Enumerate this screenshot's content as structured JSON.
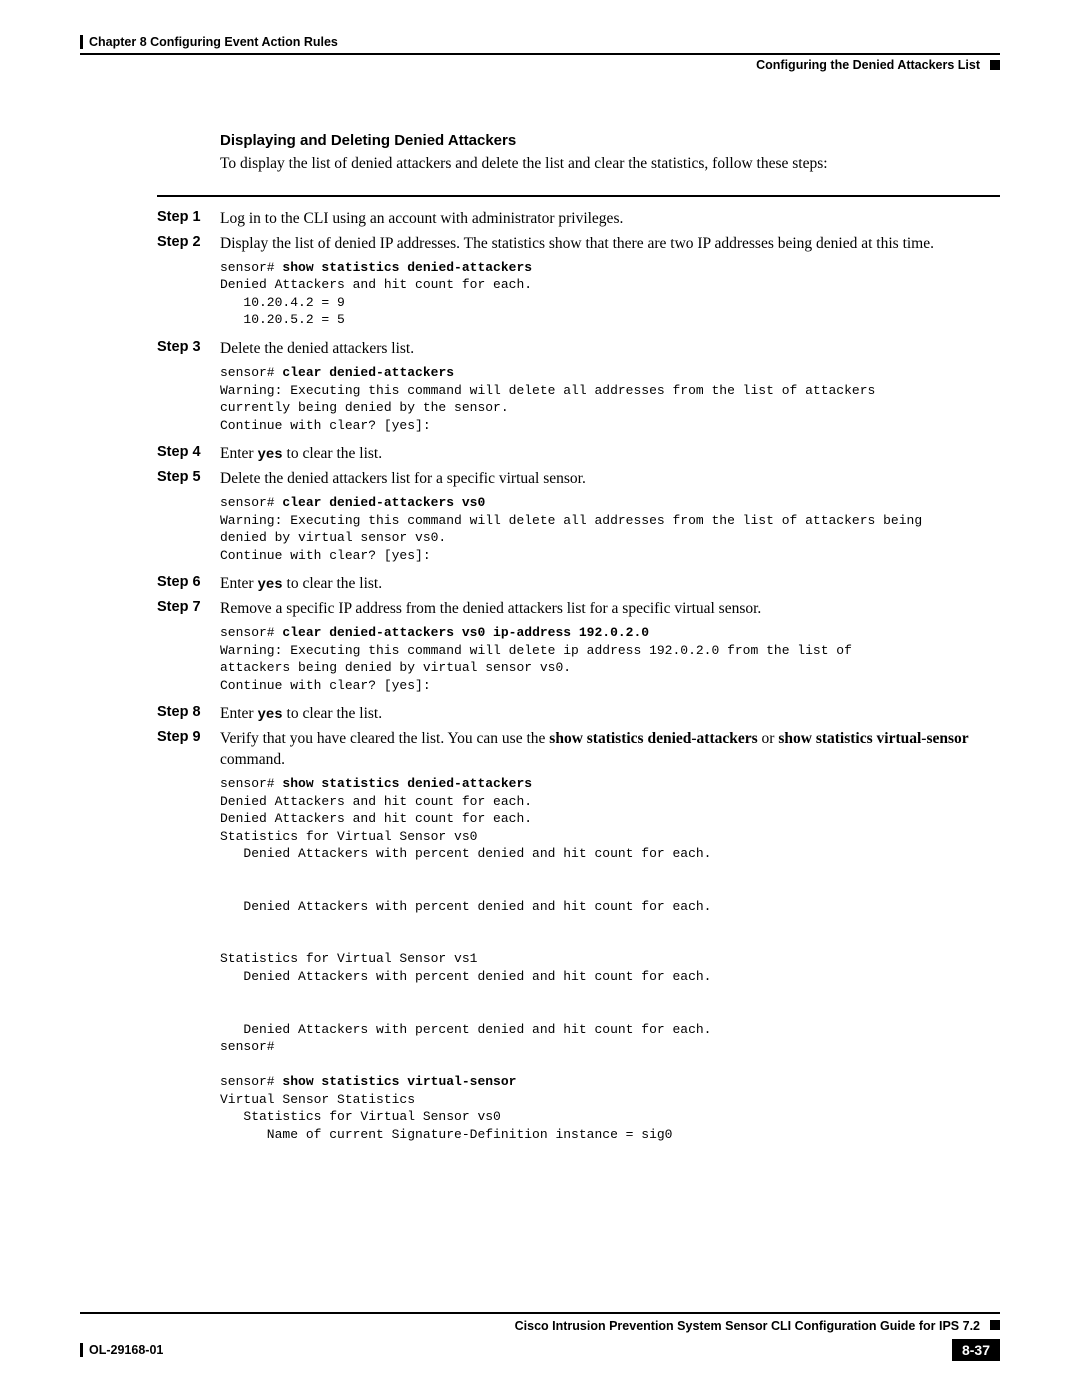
{
  "header": {
    "chapter": "Chapter 8      Configuring Event Action Rules",
    "subheader": "Configuring the Denied Attackers List"
  },
  "section": {
    "heading": "Displaying and Deleting Denied Attackers",
    "intro": "To display the list of denied attackers and delete the list and clear the statistics, follow these steps:"
  },
  "steps": {
    "s1": {
      "label": "Step 1",
      "text": "Log in to the CLI using an account with administrator privileges."
    },
    "s2": {
      "label": "Step 2",
      "text": "Display the list of denied IP addresses. The statistics show that there are two IP addresses being denied at this time."
    },
    "s3": {
      "label": "Step 3",
      "text": "Delete the denied attackers list."
    },
    "s4": {
      "label": "Step 4",
      "pre": "Enter ",
      "mono": "yes",
      "post": " to clear the list."
    },
    "s5": {
      "label": "Step 5",
      "text": "Delete the denied attackers list for a specific virtual sensor."
    },
    "s6": {
      "label": "Step 6",
      "pre": "Enter ",
      "mono": "yes",
      "post": " to clear the list."
    },
    "s7": {
      "label": "Step 7",
      "text": "Remove a specific IP address from the denied attackers list for a specific virtual sensor."
    },
    "s8": {
      "label": "Step 8",
      "pre": "Enter ",
      "mono": "yes",
      "post": " to clear the list."
    },
    "s9": {
      "label": "Step 9",
      "pre": "Verify that you have cleared the list. You can use the ",
      "b1": "show statistics denied-attackers",
      "mid": " or ",
      "b2": "show statistics virtual-sensor",
      "post": " command."
    }
  },
  "code": {
    "c1_prompt": "sensor# ",
    "c1_cmd": "show statistics denied-attackers",
    "c1_body": "Denied Attackers and hit count for each.\n   10.20.4.2 = 9\n   10.20.5.2 = 5",
    "c2_prompt": "sensor# ",
    "c2_cmd": "clear denied-attackers",
    "c2_body": "Warning: Executing this command will delete all addresses from the list of attackers \ncurrently being denied by the sensor.\nContinue with clear? [yes]:",
    "c3_prompt": "sensor# ",
    "c3_cmd": "clear denied-attackers vs0",
    "c3_body": "Warning: Executing this command will delete all addresses from the list of attackers being \ndenied by virtual sensor vs0.\nContinue with clear? [yes]:",
    "c4_prompt": "sensor# ",
    "c4_cmd": "clear denied-attackers vs0 ip-address 192.0.2.0",
    "c4_body": "Warning: Executing this command will delete ip address 192.0.2.0 from the list of \nattackers being denied by virtual sensor vs0.\nContinue with clear? [yes]:",
    "c5_prompt": "sensor# ",
    "c5_cmd": "show statistics denied-attackers",
    "c5_body": "Denied Attackers and hit count for each.\nDenied Attackers and hit count for each.\nStatistics for Virtual Sensor vs0\n   Denied Attackers with percent denied and hit count for each.\n\n\n   Denied Attackers with percent denied and hit count for each.\n\n\nStatistics for Virtual Sensor vs1\n   Denied Attackers with percent denied and hit count for each.\n\n\n   Denied Attackers with percent denied and hit count for each.\nsensor#\n",
    "c6_prompt": "sensor# ",
    "c6_cmd": "show statistics virtual-sensor",
    "c6_body": "Virtual Sensor Statistics\n   Statistics for Virtual Sensor vs0\n      Name of current Signature-Definition instance = sig0"
  },
  "footer": {
    "guide": "Cisco Intrusion Prevention System Sensor CLI Configuration Guide for IPS 7.2",
    "docnum": "OL-29168-01",
    "pagenum": "8-37"
  }
}
